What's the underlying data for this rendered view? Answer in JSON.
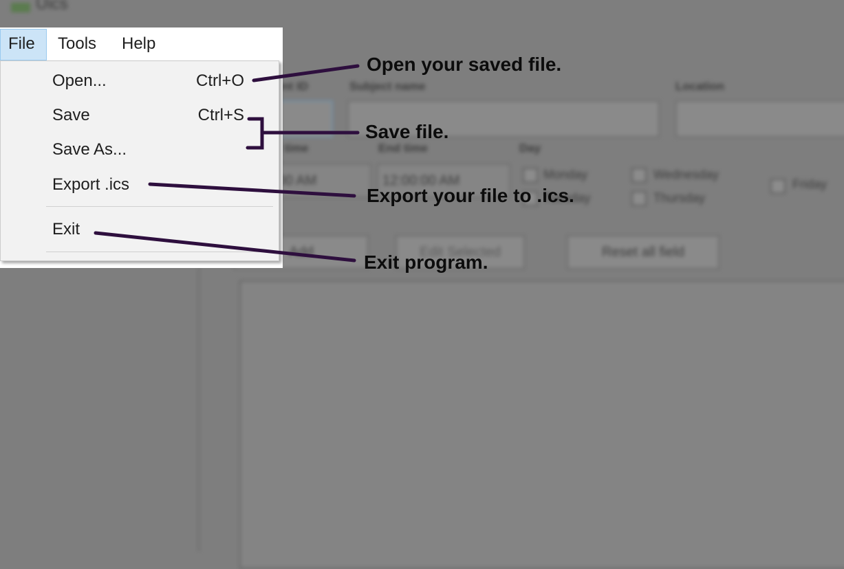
{
  "window": {
    "title": "Uics"
  },
  "background_form": {
    "labels": {
      "event_id": "Event ID",
      "subject": "Subject name",
      "location": "Location",
      "start": "Start time",
      "end": "End time",
      "day": "Day"
    },
    "start_time": "12:00:00 AM",
    "end_time": "12:00:00 AM",
    "days": [
      "Monday",
      "Tuesday",
      "Wednesday",
      "Thursday",
      "Friday"
    ],
    "buttons": {
      "add": "Add",
      "edit": "Edit Selected",
      "reset": "Reset all field"
    }
  },
  "menubar": {
    "items": [
      "File",
      "Tools",
      "Help"
    ]
  },
  "file_menu": {
    "open": {
      "label": "Open...",
      "shortcut": "Ctrl+O"
    },
    "save": {
      "label": "Save",
      "shortcut": "Ctrl+S"
    },
    "save_as": {
      "label": "Save As..."
    },
    "export": {
      "label": "Export .ics"
    },
    "exit": {
      "label": "Exit"
    }
  },
  "annotations": {
    "open": "Open your saved file.",
    "save": "Save file.",
    "export": "Export your file to .ics.",
    "exit": "Exit program."
  },
  "colors": {
    "annotation_line": "#2e0f3e",
    "menu_highlight": "#cce4f7"
  }
}
